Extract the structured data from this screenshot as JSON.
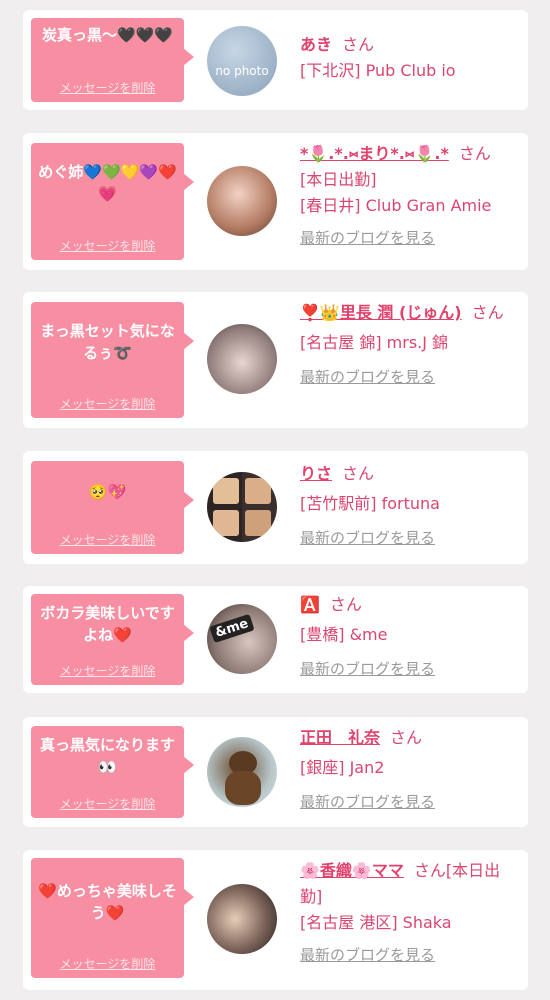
{
  "delete_label": "メッセージを削除",
  "san_label": "さん",
  "blog_label": "最新のブログを見る",
  "colors": {
    "accent": "#f78ea2",
    "name": "#e0426c",
    "text": "#d9466f",
    "muted": "#9a9a9a"
  },
  "cards": [
    {
      "message": "炭真っ黒〜🖤🖤🖤",
      "name": "あき",
      "name_linked": false,
      "lines": [
        "[下北沢] Pub Club io"
      ],
      "show_blog": false,
      "avatar_text": "no photo"
    },
    {
      "message": "めぐ姉💙💚💛💜❤️💗",
      "name": "*🌷.*.⑅まり*.⑅🌷.*",
      "name_linked": true,
      "lines": [
        "[本日出勤]",
        "[春日井] Club Gran Amie"
      ],
      "show_blog": true
    },
    {
      "message": "まっ黒セット気になるぅ➰",
      "name": "❣️👑里長 潤 (じゅん)",
      "name_linked": true,
      "lines": [
        "[名古屋 錦] mrs.J 錦"
      ],
      "show_blog": true
    },
    {
      "message": "🥺💖",
      "name": "りさ",
      "name_linked": true,
      "lines": [
        "[苫竹駅前] fortuna"
      ],
      "show_blog": true
    },
    {
      "message": "ボカラ美味しいですよね❤️",
      "name": "🅰️",
      "name_linked": false,
      "lines": [
        "[豊橋] &me"
      ],
      "show_blog": true,
      "avatar_text": "&me"
    },
    {
      "message": "真っ黒気になります👀",
      "name": "正田　礼奈",
      "name_linked": true,
      "lines": [
        "[銀座] Jan2"
      ],
      "show_blog": true
    },
    {
      "message": "❤️めっちゃ美味しそう❤️",
      "name": "🌸香織🌸ママ",
      "name_linked": true,
      "lines": [
        "[本日出勤]",
        "[名古屋 港区] Shaka"
      ],
      "show_blog": true
    }
  ]
}
